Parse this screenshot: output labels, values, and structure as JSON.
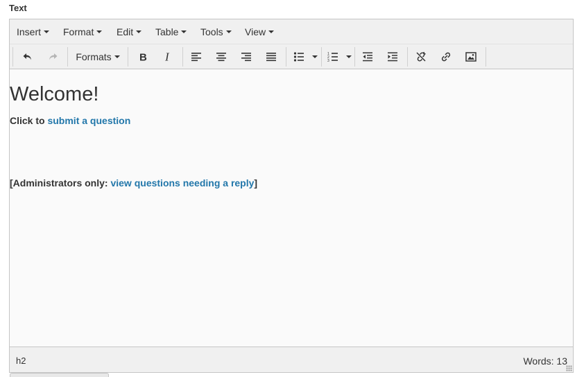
{
  "field": {
    "label": "Text"
  },
  "menubar": {
    "items": [
      {
        "label": "Insert"
      },
      {
        "label": "Format"
      },
      {
        "label": "Edit"
      },
      {
        "label": "Table"
      },
      {
        "label": "Tools"
      },
      {
        "label": "View"
      }
    ]
  },
  "toolbar": {
    "formats_label": "Formats",
    "icons": [
      "undo-icon",
      "redo-icon",
      "bold-icon",
      "italic-icon",
      "align-left-icon",
      "align-center-icon",
      "align-right-icon",
      "align-justify-icon",
      "bullet-list-icon",
      "numbered-list-icon",
      "outdent-icon",
      "indent-icon",
      "unlink-icon",
      "link-icon",
      "image-icon"
    ]
  },
  "content": {
    "heading": "Welcome!",
    "line1_prefix": "Click to ",
    "line1_link": "submit a question",
    "line2_open": "[",
    "line2_label": "Administrators only:",
    "line2_link": "view questions needing a reply",
    "line2_close": "]"
  },
  "statusbar": {
    "path": "h2",
    "wordcount": "Words: 13"
  },
  "colors": {
    "link": "#2277aa",
    "toolbar_bg": "#f0f0f0",
    "content_bg": "#fafafa"
  }
}
